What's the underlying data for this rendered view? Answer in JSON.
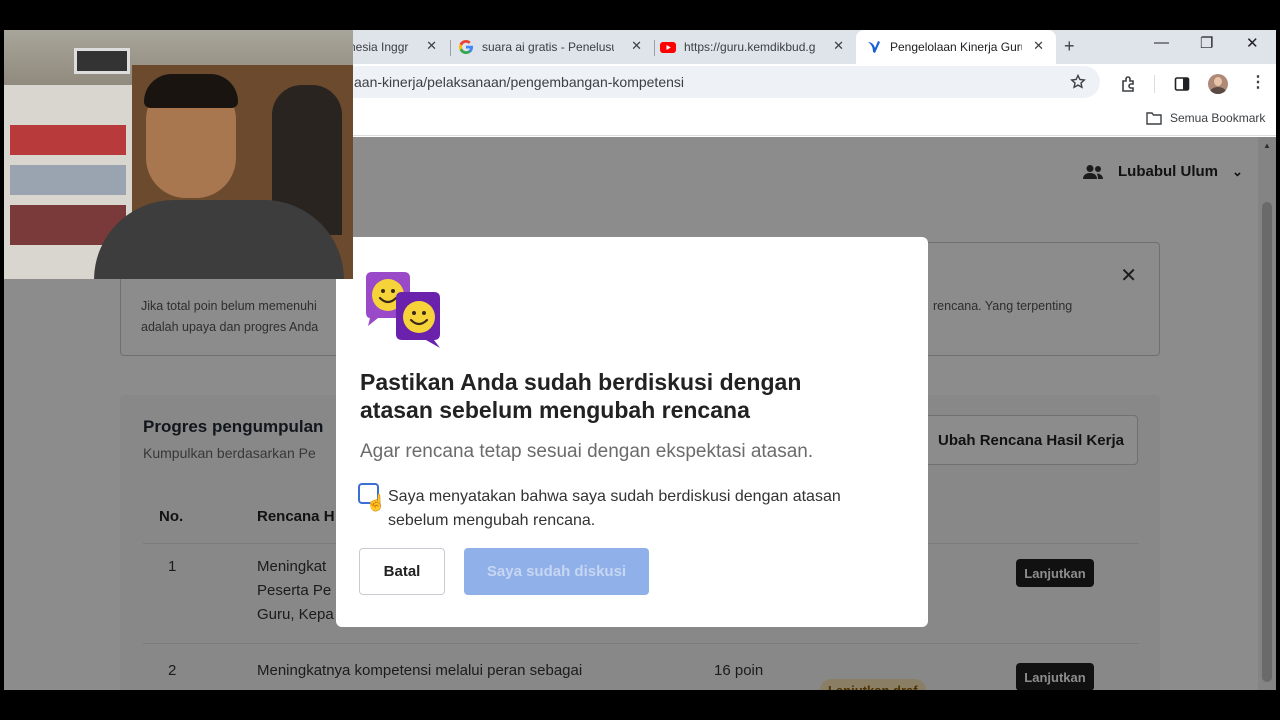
{
  "browser": {
    "tabs": [
      {
        "title": "nesia Inggr"
      },
      {
        "title": "suara ai gratis - Penelusu"
      },
      {
        "title": "https://guru.kemdikbud.g"
      },
      {
        "title": "Pengelolaan Kinerja Guru"
      }
    ],
    "new_tab": "+",
    "window": {
      "minimize": "—",
      "restore": "❐",
      "close": "✕"
    },
    "url": "aan-kinerja/pelaksanaan/pengembangan-kompetensi",
    "bookmarks_all": "Semua Bookmark",
    "icons": {
      "star": "star-icon",
      "extensions": "puzzle-icon",
      "sidepanel": "sidepanel-icon",
      "profile": "avatar",
      "menu": "kebab-icon"
    }
  },
  "page": {
    "user_name": "Lubabul Ulum",
    "info": {
      "line1_left": "Jika total poin belum memenuhi",
      "line1_right": "rencana. Yang terpenting",
      "line2_left": "adalah upaya dan progres Anda"
    },
    "progress": {
      "title": "Progres pengumpulan",
      "subtitle": "Kumpulkan berdasarkan Pe",
      "edit_button": "Ubah Rencana Hasil Kerja",
      "headers": {
        "no": "No.",
        "rencana": "Rencana H"
      },
      "rows": [
        {
          "no": "1",
          "lines": [
            "Meningkat",
            "Peserta Pe",
            "Guru, Kepa"
          ],
          "action": "Lanjutkan"
        },
        {
          "no": "2",
          "lines": [
            "Meningkatnya kompetensi melalui peran sebagai"
          ],
          "poin": "16 poin",
          "status": "Lanjutkan draf",
          "action": "Lanjutkan"
        }
      ]
    }
  },
  "modal": {
    "title": "Pastikan Anda sudah berdiskusi dengan atasan sebelum mengubah rencana",
    "subtitle": "Agar rencana tetap sesuai dengan ekspektasi atasan.",
    "checkbox_label": "Saya menyatakan bahwa saya sudah berdiskusi dengan atasan sebelum mengubah rencana.",
    "cancel": "Batal",
    "confirm": "Saya sudah diskusi"
  },
  "colors": {
    "primary_disabled": "#8fb0e8",
    "illus_purple": "#7b2fbf",
    "illus_yellow": "#f7d33a"
  }
}
